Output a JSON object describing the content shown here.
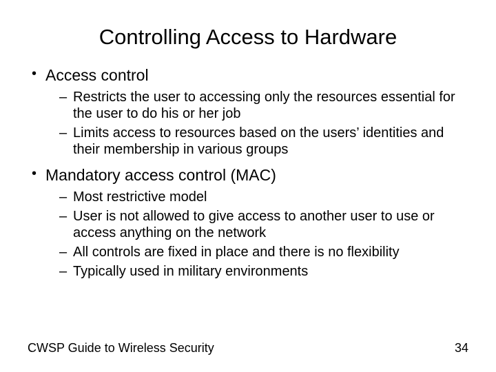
{
  "title": "Controlling Access to Hardware",
  "sections": [
    {
      "heading": "Access control",
      "items": [
        "Restricts the user to accessing only the resources essential for the user to do his or her job",
        "Limits access to resources based on the users’ identities and their membership in various groups"
      ]
    },
    {
      "heading": "Mandatory access control (MAC)",
      "items": [
        "Most restrictive model",
        "User is not allowed to give access to another user to use or access anything on the network",
        "All controls are fixed in place and there is no flexibility",
        "Typically used in military environments"
      ]
    }
  ],
  "footer": {
    "left": "CWSP Guide to Wireless Security",
    "right": "34"
  }
}
